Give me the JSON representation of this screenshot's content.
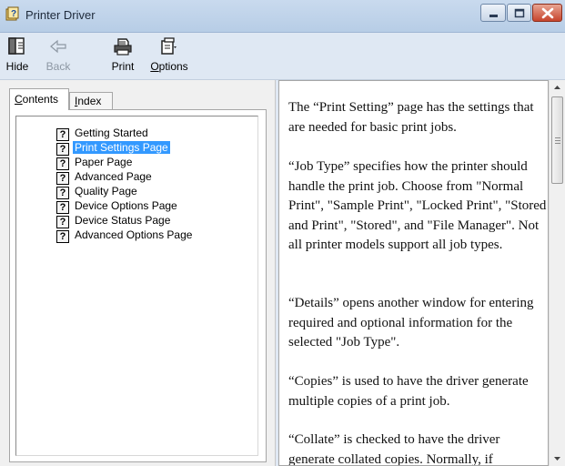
{
  "window": {
    "title": "Printer Driver",
    "colors": {
      "titlebar": "#c9daee",
      "close_button": "#c7452d",
      "selection": "#3399ff"
    }
  },
  "toolbar": {
    "hide_label": "Hide",
    "back_label": "Back",
    "print_label": "Print",
    "options_label": "Options"
  },
  "tabs": {
    "contents_label": "Contents",
    "index_label": "Index"
  },
  "tree": {
    "selected": "Print Settings Page",
    "items": [
      {
        "label": "Getting Started"
      },
      {
        "label": "Print Settings Page"
      },
      {
        "label": "Paper Page"
      },
      {
        "label": "Advanced Page"
      },
      {
        "label": "Quality Page"
      },
      {
        "label": "Device Options Page"
      },
      {
        "label": "Device Status Page"
      },
      {
        "label": "Advanced Options Page"
      }
    ]
  },
  "content": {
    "paragraphs": [
      "The “Print Setting” page has the settings that are needed for basic print jobs.",
      "“Job Type” specifies how the printer should handle the print job. Choose from \"Normal Print\", \"Sample Print\", \"Locked Print\", \"Stored and Print\", \"Stored\", and \"File Manager\". Not all printer models support all job types.",
      "“Details” opens another window for entering required and optional information for the selected \"Job Type\".",
      "“Copies” is used to have the driver generate multiple copies of a print job.",
      "“Collate” is checked to have the driver generate collated copies. Normally, if"
    ]
  }
}
